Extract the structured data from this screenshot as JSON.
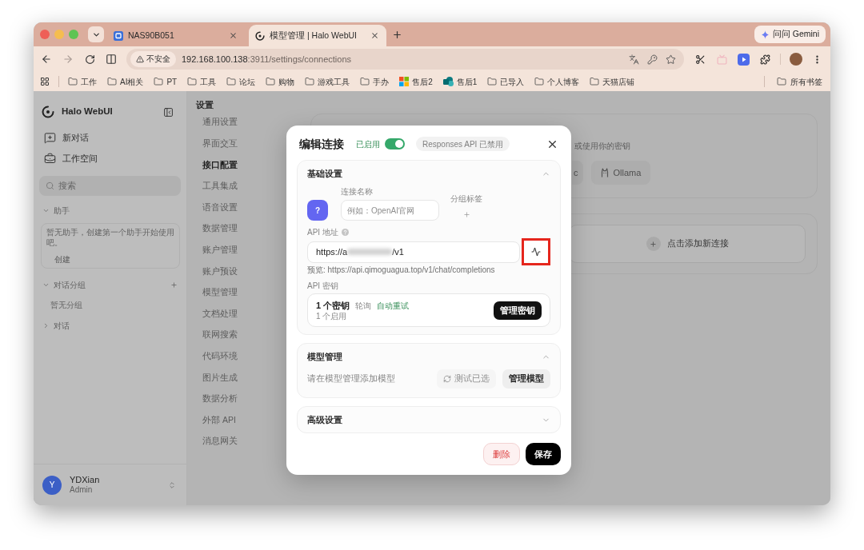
{
  "browser": {
    "tabs": [
      {
        "title": "NAS90B051",
        "kind": "square",
        "selected": false
      },
      {
        "title": "模型管理 | Halo WebUI",
        "kind": "ring",
        "selected": true
      }
    ],
    "gemini_button": "问问 Gemini",
    "address": {
      "security_label": "不安全",
      "host": "192.168.100.138",
      "path": ":3911/settings/connections"
    },
    "bookmarks": [
      {
        "label": "工作",
        "kind": "folder"
      },
      {
        "label": "AI相关",
        "kind": "folder"
      },
      {
        "label": "PT",
        "kind": "folder"
      },
      {
        "label": "工具",
        "kind": "folder"
      },
      {
        "label": "论坛",
        "kind": "folder"
      },
      {
        "label": "购物",
        "kind": "folder"
      },
      {
        "label": "游戏工具",
        "kind": "folder"
      },
      {
        "label": "手办",
        "kind": "folder"
      },
      {
        "label": "售后2",
        "kind": "tiles"
      },
      {
        "label": "售后1",
        "kind": "circles"
      },
      {
        "label": "已导入",
        "kind": "folder"
      },
      {
        "label": "个人博客",
        "kind": "folder"
      },
      {
        "label": "天猫店铺",
        "kind": "folder"
      }
    ],
    "all_bookmarks": "所有书签"
  },
  "sidebar": {
    "app_name": "Halo WebUI",
    "nav": [
      {
        "label": "新对话",
        "kind": "new_chat"
      },
      {
        "label": "工作空间",
        "kind": "workspace"
      }
    ],
    "search_placeholder": "搜索",
    "sections": [
      {
        "title": "助手",
        "expanded": true,
        "add_button": false,
        "empty_text": "暂无助手，创建第一个助手开始使用吧。",
        "action": "创建"
      },
      {
        "title": "对话分组",
        "expanded": true,
        "add_button": true,
        "empty_text": "暂无分组"
      },
      {
        "title": "对话",
        "expanded": false,
        "add_button": false
      }
    ],
    "user": {
      "initial": "Y",
      "name": "YDXian",
      "role": "Admin"
    }
  },
  "settings_nav": {
    "title": "设置",
    "items": [
      {
        "label": "通用设置",
        "selected": false
      },
      {
        "label": "界面交互",
        "selected": false
      },
      {
        "label": "接口配置",
        "selected": true
      },
      {
        "label": "工具集成",
        "selected": false
      },
      {
        "label": "语音设置",
        "selected": false
      },
      {
        "label": "数据管理",
        "selected": false
      },
      {
        "label": "账户管理",
        "selected": false
      },
      {
        "label": "账户预设",
        "selected": false
      },
      {
        "label": "模型管理",
        "selected": false
      },
      {
        "label": "文档处理",
        "selected": false
      },
      {
        "label": "联网搜索",
        "selected": false
      },
      {
        "label": "代码环境",
        "selected": false
      },
      {
        "label": "图片生成",
        "selected": false
      },
      {
        "label": "数据分析",
        "selected": false
      },
      {
        "label": "外部 API",
        "selected": false
      },
      {
        "label": "消息网关",
        "selected": false
      }
    ]
  },
  "main": {
    "provider_hint": "或使用你的密钥",
    "providers": [
      {
        "label": "c",
        "kind": "cut"
      },
      {
        "label": "Ollama",
        "kind": "animal"
      }
    ],
    "add_connection": "点击添加新连接"
  },
  "dialog": {
    "title": "编辑连接",
    "enabled_label": "已启用",
    "enabled": true,
    "responses_chip": "Responses API 已禁用",
    "sections": [
      {
        "kind": "basic",
        "title": "基础设置",
        "expanded": true,
        "avatar_text": "?",
        "name_label": "连接名称",
        "name_placeholder": "例如：OpenAI官网",
        "group_label": "分组标签",
        "url_label": "API 地址",
        "url_start": "https://a",
        "url_end": "/v1",
        "test_highlighted": true,
        "preview": "预览: https://api.qimoguagua.top/v1/chat/completions",
        "key_label": "API 密钥",
        "key_count": "1 个密钥",
        "key_mode": "轮询",
        "key_retry": "自动重试",
        "key_enabled": "1 个启用",
        "manage_keys": "管理密钥"
      },
      {
        "kind": "models",
        "title": "模型管理",
        "expanded": true,
        "empty_text": "请在模型管理添加模型",
        "test_button": "测试已选",
        "test_disabled": true,
        "manage_button": "管理模型"
      },
      {
        "kind": "advanced",
        "title": "高级设置",
        "expanded": false
      }
    ],
    "delete_button": "删除",
    "save_button": "保存"
  }
}
